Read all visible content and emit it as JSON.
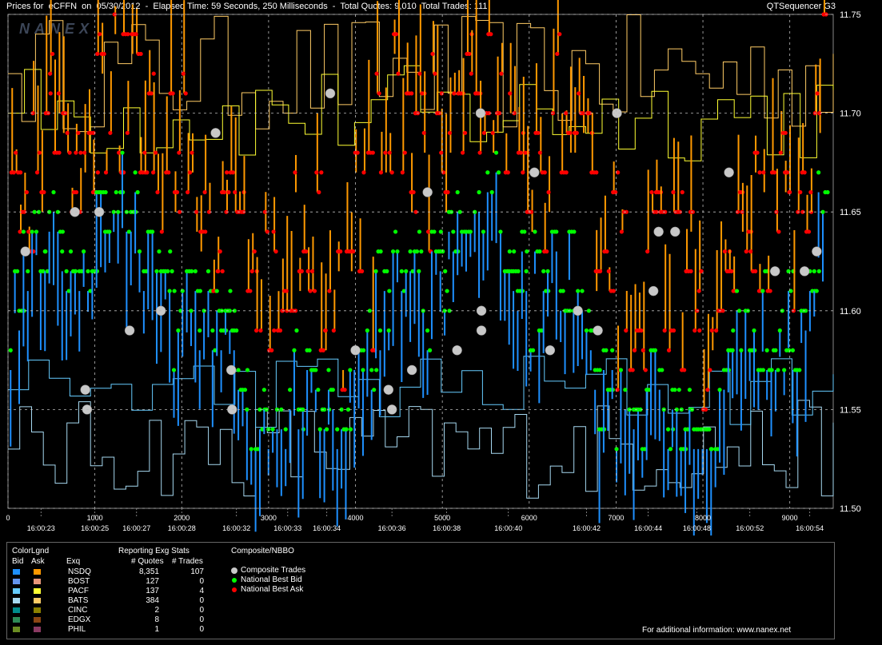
{
  "title": {
    "left": "Prices for  eCFFN  on  05/30/2012  -  Elapsed Time: 59 Seconds, 250 Milliseconds  -  Total Quotes: 9,010  Total Trades: 111",
    "right": "QTSequencer G3",
    "watermark": "NANEX"
  },
  "chart_data": {
    "type": "line",
    "ylim": [
      11.5,
      11.75
    ],
    "y_ticks": [
      "11.75",
      "11.70",
      "11.65",
      "11.60",
      "11.55",
      "11.50"
    ],
    "xlim": [
      0,
      9500
    ],
    "x_ticks": [
      "0",
      "1000",
      "2000",
      "3000",
      "4000",
      "5000",
      "6000",
      "7000",
      "8000",
      "9000"
    ],
    "time_labels": [
      {
        "x": 380,
        "label": "16:00:23"
      },
      {
        "x": 1000,
        "label": "16:00:25"
      },
      {
        "x": 1480,
        "label": "16:00:27"
      },
      {
        "x": 2000,
        "label": "16:00:28"
      },
      {
        "x": 2630,
        "label": "16:00:32"
      },
      {
        "x": 3220,
        "label": "16:00:33"
      },
      {
        "x": 3670,
        "label": "16:00:34"
      },
      {
        "x": 4420,
        "label": "16:00:36"
      },
      {
        "x": 5050,
        "label": "16:00:38"
      },
      {
        "x": 5760,
        "label": "16:00:40"
      },
      {
        "x": 6660,
        "label": "16:00:42"
      },
      {
        "x": 7370,
        "label": "16:00:44"
      },
      {
        "x": 7930,
        "label": "16:00:48"
      },
      {
        "x": 8540,
        "label": "16:00:52"
      },
      {
        "x": 9230,
        "label": "16:00:54"
      }
    ],
    "grid": true,
    "composite_trades": [
      {
        "x": 200,
        "y": 11.63
      },
      {
        "x": 770,
        "y": 11.65
      },
      {
        "x": 890,
        "y": 11.56
      },
      {
        "x": 910,
        "y": 11.55
      },
      {
        "x": 1050,
        "y": 11.65
      },
      {
        "x": 1400,
        "y": 11.59
      },
      {
        "x": 1760,
        "y": 11.6
      },
      {
        "x": 2390,
        "y": 11.69
      },
      {
        "x": 2570,
        "y": 11.57
      },
      {
        "x": 2580,
        "y": 11.55
      },
      {
        "x": 3710,
        "y": 11.71
      },
      {
        "x": 4000,
        "y": 11.58
      },
      {
        "x": 4380,
        "y": 11.56
      },
      {
        "x": 4420,
        "y": 11.55
      },
      {
        "x": 4650,
        "y": 11.57
      },
      {
        "x": 4830,
        "y": 11.66
      },
      {
        "x": 5170,
        "y": 11.58
      },
      {
        "x": 5440,
        "y": 11.7
      },
      {
        "x": 5450,
        "y": 11.6
      },
      {
        "x": 5450,
        "y": 11.59
      },
      {
        "x": 6060,
        "y": 11.67
      },
      {
        "x": 6240,
        "y": 11.58
      },
      {
        "x": 6560,
        "y": 11.6
      },
      {
        "x": 6790,
        "y": 11.59
      },
      {
        "x": 7010,
        "y": 11.7
      },
      {
        "x": 7430,
        "y": 11.61
      },
      {
        "x": 7490,
        "y": 11.64
      },
      {
        "x": 7680,
        "y": 11.64
      },
      {
        "x": 8300,
        "y": 11.67
      },
      {
        "x": 8830,
        "y": 11.62
      },
      {
        "x": 9170,
        "y": 11.62
      },
      {
        "x": 9310,
        "y": 11.63
      }
    ]
  },
  "legend": {
    "color_legend": "ColorLgnd",
    "bid": "Bid",
    "ask": "Ask",
    "exq": "Exq",
    "reporting_title": "Reporting Exg Stats",
    "quotes_header": "# Quotes",
    "trades_header": "# Trades",
    "exchanges": [
      {
        "name": "NSDQ",
        "quotes": "8,351",
        "trades": "107",
        "bid_color": "#1e90ff",
        "ask_color": "#ff9900"
      },
      {
        "name": "BOST",
        "quotes": "127",
        "trades": "0",
        "bid_color": "#6495ed",
        "ask_color": "#e9967a"
      },
      {
        "name": "PACF",
        "quotes": "137",
        "trades": "4",
        "bid_color": "#66ccff",
        "ask_color": "#ffff33"
      },
      {
        "name": "BATS",
        "quotes": "384",
        "trades": "0",
        "bid_color": "#a6d8f0",
        "ask_color": "#ffcc66"
      },
      {
        "name": "CINC",
        "quotes": "2",
        "trades": "0",
        "bid_color": "#008b8b",
        "ask_color": "#8b8000"
      },
      {
        "name": "EDGX",
        "quotes": "8",
        "trades": "0",
        "bid_color": "#2e8b57",
        "ask_color": "#8b4513"
      },
      {
        "name": "PHIL",
        "quotes": "1",
        "trades": "0",
        "bid_color": "#6b8e23",
        "ask_color": "#8b3a62"
      }
    ],
    "composite_title": "Composite/NBBO",
    "composite_items": [
      {
        "label": "Composite Trades",
        "color": "#c8c8c8"
      },
      {
        "label": "National Best Bid",
        "color": "#00ff00"
      },
      {
        "label": "National Best Ask",
        "color": "#ff0000"
      }
    ],
    "footer": "For additional information: www.nanex.net"
  }
}
